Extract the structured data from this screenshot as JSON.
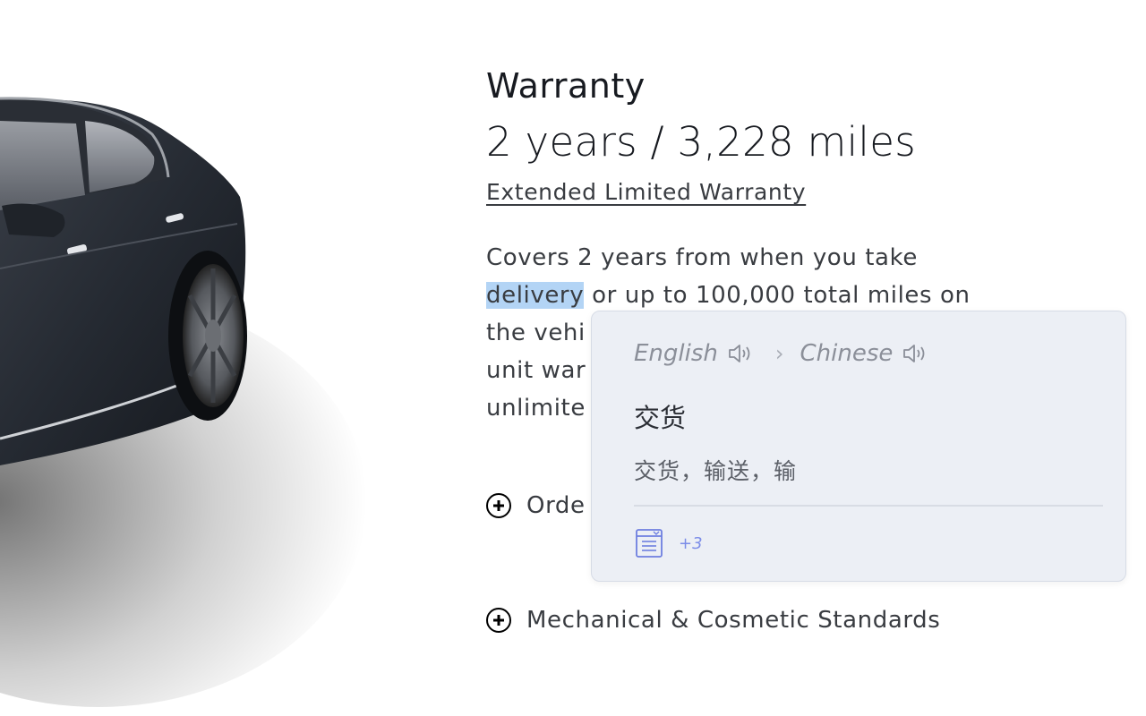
{
  "warranty": {
    "heading": "Warranty",
    "summary": "2 years / 3,228 miles",
    "extended_link": "Extended Limited Warranty",
    "description_lines": {
      "line1": "Covers 2 years from when you take",
      "highlight": "delivery",
      "line2_rest": " or up to 100,000 total miles on",
      "line3": "the vehi",
      "line4": "unit war",
      "line5": "unlimite"
    }
  },
  "accordions": {
    "order": "Orde",
    "mechanical": "Mechanical & Cosmetic Standards"
  },
  "translator": {
    "source_lang": "English",
    "target_lang": "Chinese",
    "separator": "›",
    "word": "交货",
    "meanings": "交货，输送，输",
    "more_count": "+3",
    "icons": {
      "source_speaker": "speaker-icon",
      "target_speaker": "speaker-icon",
      "details": "dictionary-list-icon"
    },
    "colors": {
      "background": "#eceff5",
      "accent": "#7b8ce8"
    }
  },
  "colors": {
    "text_dark": "#171a20",
    "text_body": "#393c41",
    "selection": "#b3d4f5"
  }
}
